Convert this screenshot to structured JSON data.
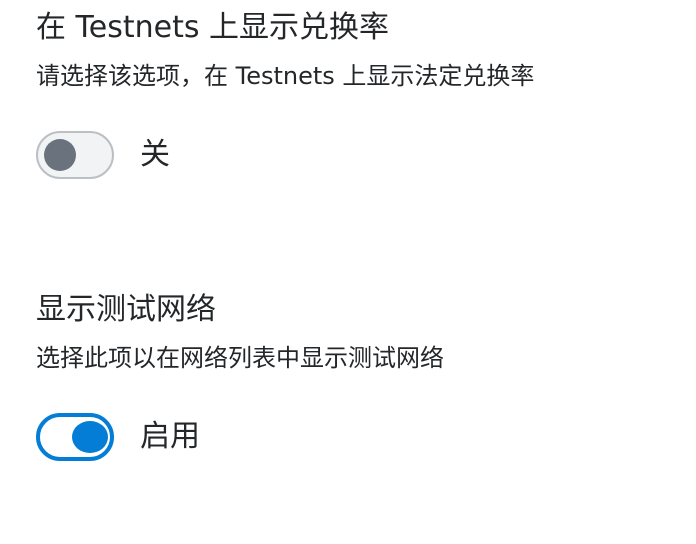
{
  "settings": [
    {
      "title": "在 Testnets 上显示兑换率",
      "description": "请选择该选项，在 Testnets 上显示法定兑换率",
      "toggle": {
        "state": "off",
        "label": "关"
      }
    },
    {
      "title": "显示测试网络",
      "description": "选择此项以在网络列表中显示测试网络",
      "toggle": {
        "state": "on",
        "label": "启用"
      }
    }
  ],
  "colors": {
    "accent": "#037dd6",
    "text": "#24272a",
    "toggle_off_knob": "#6a737d",
    "toggle_off_border": "#bbc0c5",
    "toggle_off_bg": "#f2f3f4"
  }
}
